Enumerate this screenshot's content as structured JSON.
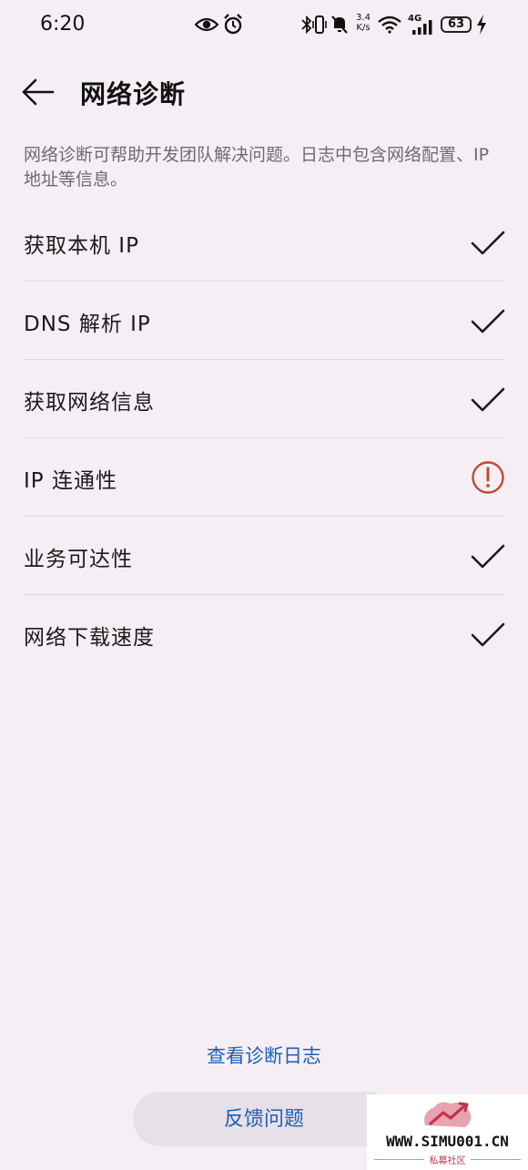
{
  "status_bar": {
    "time": "6:20",
    "net_speed_value": "3.4",
    "net_speed_unit": "K/s",
    "network_type": "4G",
    "battery": "63",
    "icons": [
      "eye-icon",
      "alarm-icon",
      "bluetooth-icon",
      "vibrate-icon",
      "mute-icon",
      "wifi-icon",
      "signal-icon",
      "charging-icon"
    ]
  },
  "header": {
    "back_icon": "arrow-left-icon",
    "title": "网络诊断"
  },
  "description": "网络诊断可帮助开发团队解决问题。日志中包含网络配置、IP 地址等信息。",
  "checks": [
    {
      "label": "获取本机 IP",
      "status": "ok"
    },
    {
      "label": "DNS 解析 IP",
      "status": "ok"
    },
    {
      "label": "获取网络信息",
      "status": "ok"
    },
    {
      "label": "IP 连通性",
      "status": "error"
    },
    {
      "label": "业务可达性",
      "status": "ok"
    },
    {
      "label": "网络下载速度",
      "status": "ok"
    }
  ],
  "actions": {
    "view_log": "查看诊断日志",
    "feedback": "反馈问题"
  },
  "watermark": {
    "url": "WWW.SIMU001.CN",
    "subtitle": "私募社区"
  },
  "colors": {
    "background": "#f5eff5",
    "accent": "#1f5fb5",
    "error": "#c4472e",
    "text": "#1a1a1a",
    "secondary_text": "#6f6a70"
  }
}
